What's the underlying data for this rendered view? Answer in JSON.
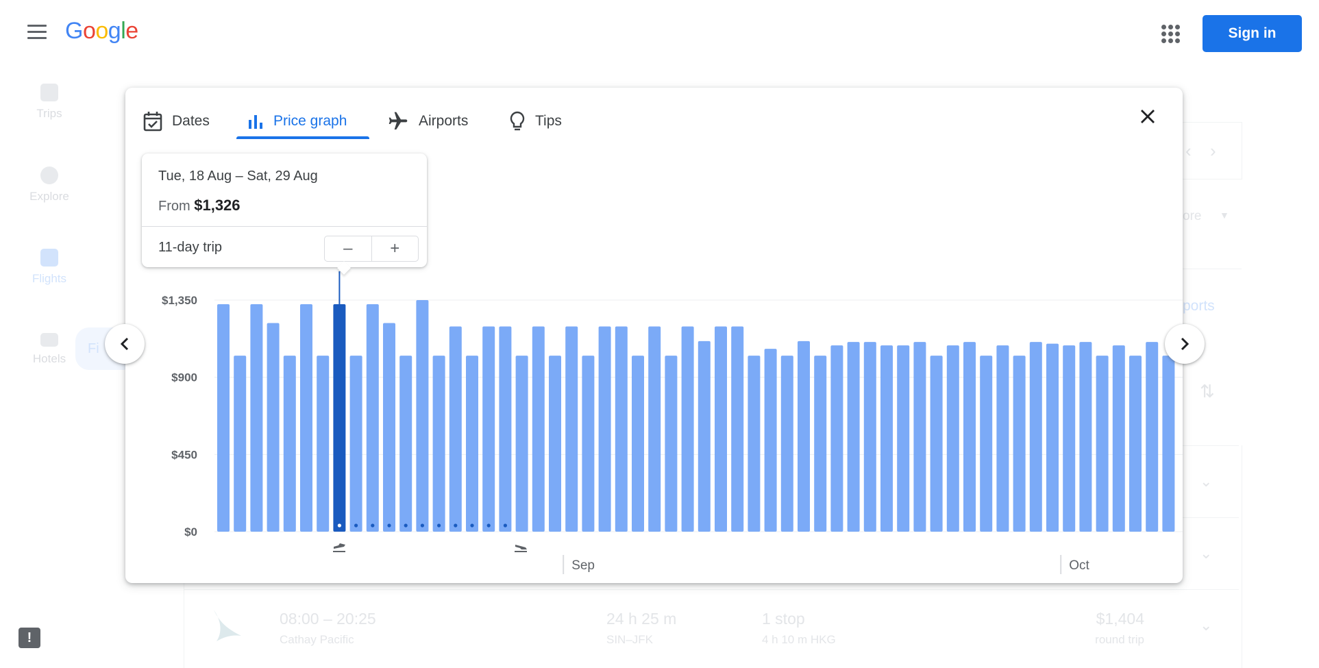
{
  "header": {
    "logo": [
      "G",
      "o",
      "o",
      "g",
      "l",
      "e"
    ],
    "signin_label": "Sign in"
  },
  "sidebar": {
    "items": [
      {
        "label": "Trips"
      },
      {
        "label": "Explore"
      },
      {
        "label": "Flights"
      },
      {
        "label": "Hotels"
      }
    ],
    "fab_label": "Fi"
  },
  "background": {
    "more_label": "ore",
    "airports_label": "ports",
    "row": {
      "time": "08:00 – 20:25",
      "airline": "Cathay Pacific",
      "duration": "24 h 25 m",
      "route": "SIN–JFK",
      "stops": "1 stop",
      "stop_detail": "4 h 10 m HKG",
      "price": "$1,404",
      "price_note": "round trip"
    }
  },
  "popup": {
    "tabs": [
      {
        "label": "Dates",
        "icon": "calendar-check-icon"
      },
      {
        "label": "Price graph",
        "icon": "bar-chart-icon"
      },
      {
        "label": "Airports",
        "icon": "airplane-icon"
      },
      {
        "label": "Tips",
        "icon": "lightbulb-icon"
      }
    ],
    "active_tab": "Price graph"
  },
  "tooltip": {
    "dates": "Tue, 18 Aug – Sat, 29 Aug",
    "from_prefix": "From",
    "price": "$1,326",
    "trip_length": "11-day trip",
    "minus": "–",
    "plus": "+"
  },
  "colors": {
    "bar": "#7baaf7",
    "bar_selected": "#1a5bbf",
    "accent": "#1a73e8"
  },
  "chart_data": {
    "type": "bar",
    "yaxis_ticks": [
      "$0",
      "$450",
      "$900",
      "$1,350"
    ],
    "ylim": [
      0,
      1350
    ],
    "month_labels": [
      {
        "label": "Sep",
        "after_index": 20
      },
      {
        "label": "Oct",
        "after_index": 50
      }
    ],
    "selected_index": 7,
    "trip_days": 11,
    "values": [
      1326,
      1026,
      1326,
      1216,
      1026,
      1326,
      1026,
      1326,
      1026,
      1326,
      1216,
      1026,
      1350,
      1026,
      1196,
      1026,
      1196,
      1196,
      1026,
      1196,
      1026,
      1196,
      1026,
      1196,
      1196,
      1026,
      1196,
      1026,
      1196,
      1111,
      1196,
      1196,
      1026,
      1066,
      1026,
      1111,
      1026,
      1086,
      1106,
      1106,
      1086,
      1086,
      1106,
      1026,
      1086,
      1106,
      1026,
      1086,
      1026,
      1106,
      1096,
      1086,
      1106,
      1026,
      1086,
      1026,
      1106,
      1026
    ]
  }
}
